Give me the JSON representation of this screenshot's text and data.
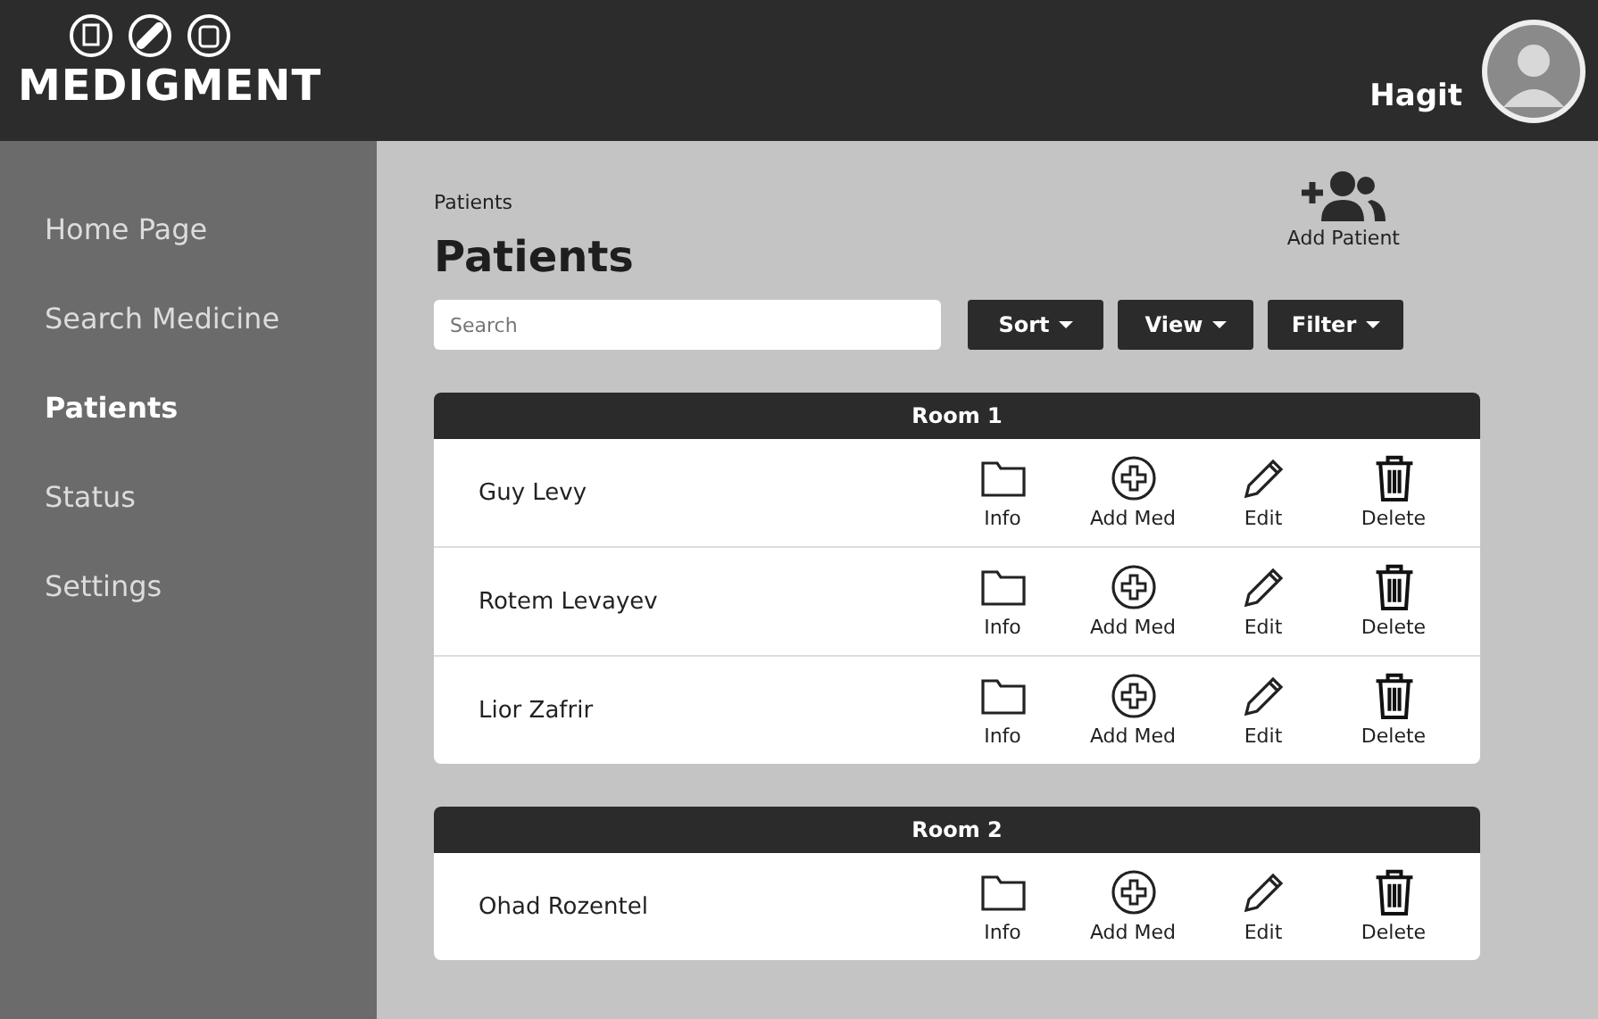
{
  "header": {
    "logo": "MEDIGMENT",
    "user": "Hagit"
  },
  "sidebar": {
    "items": [
      {
        "label": "Home Page",
        "selected": false
      },
      {
        "label": "Search Medicine",
        "selected": false
      },
      {
        "label": "Patients",
        "selected": true
      },
      {
        "label": "Status",
        "selected": false
      },
      {
        "label": "Settings",
        "selected": false
      }
    ]
  },
  "breadcrumb": "Patients",
  "title": "Patients",
  "add_patient": "Add Patient",
  "search": {
    "placeholder": "Search"
  },
  "buttons": [
    "Sort",
    "View",
    "Filter"
  ],
  "rooms": [
    {
      "name": "Room 1",
      "patients": [
        {
          "name": "Guy Levy",
          "actions": [
            {
              "kind": "info",
              "label": "Info"
            },
            {
              "kind": "add",
              "label": "Add Med"
            },
            {
              "kind": "edit",
              "label": "Edit"
            },
            {
              "kind": "delete",
              "label": "Delete"
            }
          ]
        },
        {
          "name": "Rotem Levayev",
          "actions": [
            {
              "kind": "info",
              "label": "Info"
            },
            {
              "kind": "add",
              "label": "Add Med"
            },
            {
              "kind": "edit",
              "label": "Edit"
            },
            {
              "kind": "delete",
              "label": "Delete"
            }
          ]
        },
        {
          "name": "Lior Zafrir",
          "actions": [
            {
              "kind": "info",
              "label": "Info"
            },
            {
              "kind": "add",
              "label": "Add Med"
            },
            {
              "kind": "edit",
              "label": "Edit"
            },
            {
              "kind": "delete",
              "label": "Delete"
            }
          ]
        }
      ]
    },
    {
      "name": "Room 2",
      "patients": [
        {
          "name": "Ohad Rozentel",
          "actions": [
            {
              "kind": "info",
              "label": "Info"
            },
            {
              "kind": "add",
              "label": "Add Med"
            },
            {
              "kind": "edit",
              "label": "Edit"
            },
            {
              "kind": "delete",
              "label": "Delete"
            }
          ]
        }
      ]
    }
  ]
}
